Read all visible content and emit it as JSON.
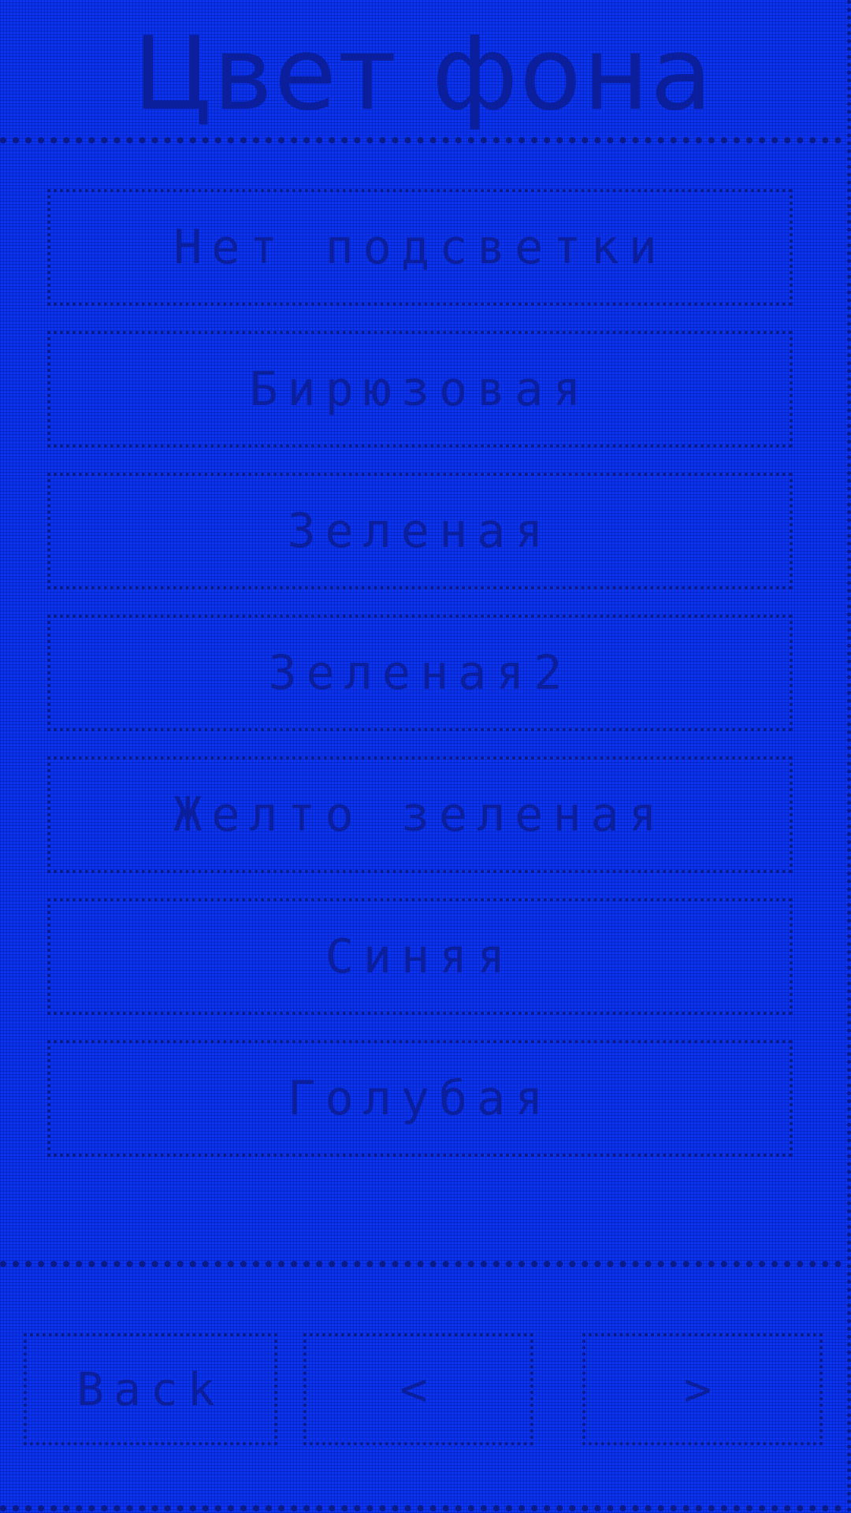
{
  "header": {
    "title": "Цвет фона"
  },
  "menu": {
    "items": [
      {
        "label": "Нет подсветки"
      },
      {
        "label": "Бирюзовая"
      },
      {
        "label": "Зеленая"
      },
      {
        "label": "Зеленая2"
      },
      {
        "label": "Желто зеленая"
      },
      {
        "label": "Синяя"
      },
      {
        "label": "Голубая"
      }
    ]
  },
  "nav": {
    "back_label": "Back",
    "prev_label": "<",
    "next_label": ">"
  },
  "colors": {
    "background": "#0a34f0",
    "text": "#0b1f9c",
    "border": "#0a1a86"
  }
}
